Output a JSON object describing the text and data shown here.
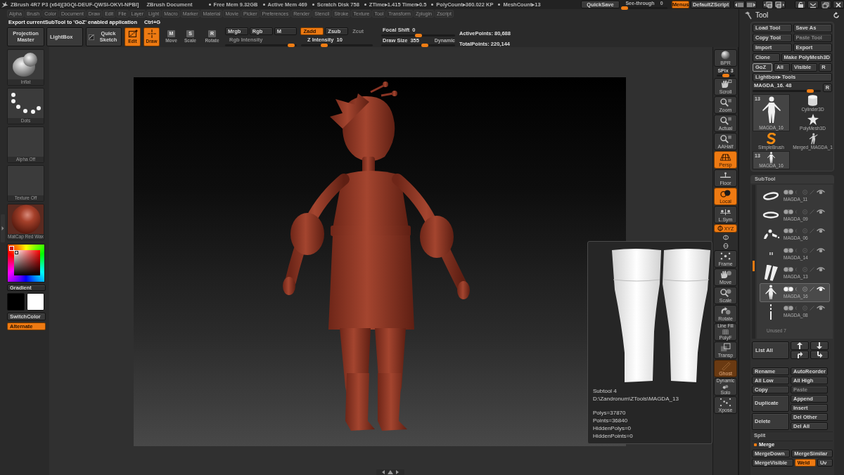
{
  "title_bar": {
    "app_title": "ZBrush 4R7 P3 (x64)[3GQI-DEUF-QWSI-OKVI-NPBI]",
    "document": "ZBrush Document",
    "stats": [
      "Free Mem 9.32GB",
      "Active Mem 469",
      "Scratch Disk 758",
      "ZTime▸1.415 Timer▸0.5",
      "PolyCount▸360.022 KP",
      "MeshCount▸13"
    ],
    "quick_save": "QuickSave",
    "see_through": {
      "label": "See-through",
      "value": "0",
      "level": 0
    },
    "menus": {
      "label": "Menus",
      "on": true
    },
    "script": "DefaultZScript"
  },
  "menu_bar": [
    "Alpha",
    "Brush",
    "Color",
    "Document",
    "Draw",
    "Edit",
    "File",
    "Layer",
    "Light",
    "Macro",
    "Marker",
    "Material",
    "Movie",
    "Picker",
    "Preferences",
    "Render",
    "Stencil",
    "Stroke",
    "Texture",
    "Tool",
    "Transform",
    "Zplugin",
    "Zscript"
  ],
  "hint": {
    "text": "Export currentSubTool to 'GoZ' enabled application",
    "shortcut": "Ctrl+G"
  },
  "top_shelf": {
    "projection_master": "Projection Master",
    "lightbox": "LightBox",
    "quick_sketch": "Quick Sketch",
    "transform_modes": [
      {
        "label": "Edit",
        "kind": "edit",
        "on": true
      },
      {
        "label": "Draw",
        "kind": "draw",
        "on": true
      },
      {
        "label": "Move",
        "kind": "tile",
        "glyph": "M",
        "on": false
      },
      {
        "label": "Scale",
        "kind": "tile",
        "glyph": "S",
        "on": false
      },
      {
        "label": "Rotate",
        "kind": "tile",
        "glyph": "R",
        "on": false
      }
    ],
    "channels": [
      {
        "label": "Mrgb",
        "on": false,
        "disabled": false
      },
      {
        "label": "Rgb",
        "on": false,
        "disabled": false
      },
      {
        "label": "M",
        "on": false,
        "disabled": false
      },
      {
        "label": "Zadd",
        "on": true,
        "disabled": false
      },
      {
        "label": "Zsub",
        "on": false,
        "disabled": false
      },
      {
        "label": "Zcut",
        "on": false,
        "disabled": true
      }
    ],
    "intensity_sliders": [
      {
        "label": "Rgb Intensity",
        "disabled": true,
        "level": 0.97
      },
      {
        "label": "Z Intensity",
        "value": "10",
        "disabled": false,
        "level": 0.3
      }
    ],
    "brush_sliders": [
      {
        "label": "Focal Shift",
        "value": "0",
        "level": 0.5
      },
      {
        "label": "Draw Size",
        "value": "355",
        "level": 0.6
      }
    ],
    "dynamic": "Dynamic",
    "points": [
      "ActivePoints: 80,688",
      "TotalPoints: 220,144"
    ]
  },
  "left_tray": {
    "thumbs": [
      {
        "label": "Inflat",
        "kind": "brush"
      },
      {
        "label": "Dots",
        "kind": "stroke"
      },
      {
        "label": "Alpha Off",
        "kind": "blank"
      },
      {
        "label": "Texture Off",
        "kind": "blank"
      },
      {
        "label": "MatCap Red Wax",
        "kind": "material"
      }
    ],
    "gradient": "Gradient",
    "swatches": [
      {
        "color": "#000000"
      },
      {
        "color": "#ffffff"
      }
    ],
    "switch_color": "SwitchColor",
    "alternate": {
      "label": "Alternate",
      "on": true
    }
  },
  "right_shelf": [
    {
      "kind": "bpr",
      "label": "BPR",
      "on": false,
      "disabled": false
    },
    {
      "kind": "spix",
      "label": "SPix",
      "value": "3",
      "level": 0.5
    },
    {
      "kind": "scroll",
      "label": "Scroll",
      "on": false,
      "disabled": false
    },
    {
      "kind": "zoom",
      "label": "Zoom",
      "on": false,
      "disabled": false
    },
    {
      "kind": "actual",
      "label": "Actual",
      "on": false,
      "disabled": false
    },
    {
      "kind": "aahalf",
      "label": "AAHalf",
      "on": false,
      "disabled": false
    },
    {
      "kind": "persp",
      "label": "Persp",
      "on": true,
      "disabled": false
    },
    {
      "kind": "floor",
      "label": "Floor",
      "on": false,
      "disabled": false
    },
    {
      "kind": "local",
      "label": "Local",
      "on": true,
      "disabled": false
    },
    {
      "kind": "lsym",
      "label": "L.Sym",
      "on": false,
      "disabled": false
    },
    {
      "kind": "xyz",
      "label": "XYZ",
      "on": true,
      "disabled": false
    },
    {
      "kind": "rot_y",
      "on": false,
      "disabled": false
    },
    {
      "kind": "rot_z",
      "on": false,
      "disabled": false
    },
    {
      "kind": "frame",
      "label": "Frame",
      "on": false,
      "disabled": false
    },
    {
      "kind": "move",
      "label": "Move",
      "on": false,
      "disabled": false
    },
    {
      "kind": "scale",
      "label": "Scale",
      "on": false,
      "disabled": false
    },
    {
      "kind": "rotate",
      "label": "Rotate",
      "on": false,
      "disabled": false
    },
    {
      "kind": "polyf",
      "label": "PolyF",
      "tag": "Line Fill",
      "on": false,
      "disabled": false
    },
    {
      "kind": "transp",
      "label": "Transp",
      "on": false,
      "disabled": false
    },
    {
      "kind": "ghost",
      "label": "Ghost",
      "on": true,
      "disabled": true
    },
    {
      "kind": "solo",
      "label": "Solo",
      "tag": "Dynamic",
      "on": false,
      "disabled": false
    },
    {
      "kind": "xpose",
      "label": "Xpose",
      "on": false,
      "disabled": false
    }
  ],
  "subtool_info": {
    "title": "Subtool 4",
    "path": "D:\\Zandronum\\ZTools\\MAGDA_13",
    "stats": [
      "Polys=37870",
      "Points=36840",
      "HiddenPolys=0",
      "HiddenPoints=0"
    ]
  },
  "tool_panel": {
    "title": "Tool",
    "rows": [
      [
        {
          "label": "Load Tool",
          "disabled": false,
          "hovered": false
        },
        {
          "label": "Save As",
          "disabled": false,
          "hovered": false
        }
      ],
      [
        {
          "label": "Copy Tool",
          "disabled": false,
          "hovered": false
        },
        {
          "label": "Paste Tool",
          "disabled": true,
          "hovered": false
        }
      ],
      [
        {
          "label": "Import",
          "disabled": false,
          "hovered": false
        },
        {
          "label": "Export",
          "disabled": false,
          "hovered": false
        }
      ],
      [
        {
          "label": "Clone",
          "disabled": false,
          "hovered": false
        },
        {
          "label": "Make PolyMesh3D",
          "disabled": false,
          "hovered": false
        }
      ],
      [
        {
          "label": "GoZ",
          "disabled": false,
          "hovered": true
        },
        {
          "label": "All",
          "disabled": false,
          "hovered": false
        },
        {
          "label": "Visible",
          "disabled": false,
          "hovered": false
        },
        {
          "label": "R",
          "disabled": false,
          "hovered": false
        }
      ],
      [
        {
          "label": "Lightbox▸ Tools",
          "disabled": false,
          "hovered": false
        }
      ]
    ],
    "current": {
      "label": "MAGDA_16. 48",
      "level": 0.88,
      "reset": "R"
    },
    "tools": [
      {
        "label": "MAGDA_16",
        "count": "13",
        "kind": "figure",
        "large": true
      },
      {
        "label": "Cylinder3D",
        "kind": "cylinder",
        "large": false
      },
      {
        "label": "PolyMesh3D",
        "kind": "star",
        "large": false
      },
      {
        "label": "SimpleBrush",
        "kind": "swirl",
        "large": false
      },
      {
        "label": "Merged_MAGDA_1",
        "kind": "pose",
        "large": false
      },
      {
        "label": "MAGDA_16",
        "count": "13",
        "kind": "figure",
        "large": false
      }
    ]
  },
  "subtool_panel": {
    "title": "SubTool",
    "subtools": [
      {
        "name": "MAGDA_11",
        "kind": "ring",
        "selected": false,
        "visible": true
      },
      {
        "name": "MAGDA_09",
        "kind": "band",
        "selected": false,
        "visible": true
      },
      {
        "name": "MAGDA_06",
        "kind": "top",
        "selected": false,
        "visible": true
      },
      {
        "name": "MAGDA_14",
        "kind": "bits",
        "selected": false,
        "visible": true
      },
      {
        "name": "MAGDA_13",
        "kind": "legs",
        "selected": false,
        "visible": true
      },
      {
        "name": "MAGDA_16",
        "kind": "figure",
        "selected": true,
        "visible": true
      },
      {
        "name": "MAGDA_08",
        "kind": "stick",
        "selected": false,
        "visible": true
      }
    ],
    "unused": "Unused 7",
    "list_all": "List All",
    "action_rows": [
      {
        "kind": "pair",
        "buttons": [
          {
            "label": "Rename",
            "disabled": false
          },
          {
            "label": "AutoReorder",
            "disabled": false
          }
        ]
      },
      {
        "kind": "pair",
        "buttons": [
          {
            "label": "All Low",
            "disabled": false
          },
          {
            "label": "All High",
            "disabled": false
          }
        ]
      },
      {
        "kind": "pair",
        "buttons": [
          {
            "label": "Copy",
            "disabled": false
          },
          {
            "label": "Paste",
            "disabled": true
          }
        ]
      },
      {
        "kind": "stack",
        "main": {
          "label": "Duplicate",
          "disabled": false
        },
        "buttons": [
          {
            "label": "Append",
            "disabled": false
          },
          {
            "label": "Insert",
            "disabled": false
          }
        ]
      },
      {
        "kind": "stack",
        "main": {
          "label": "Delete",
          "disabled": false
        },
        "buttons": [
          {
            "label": "Del Other",
            "disabled": false
          },
          {
            "label": "Del All",
            "disabled": false
          }
        ]
      }
    ],
    "sections": [
      {
        "label": "Split",
        "expanded": false
      },
      {
        "label": "Merge",
        "expanded": true,
        "rows": [
          [
            {
              "label": "MergeDown",
              "on": false
            },
            {
              "label": "MergeSimilar",
              "on": false
            }
          ],
          [
            {
              "label": "MergeVisible",
              "on": false
            },
            {
              "label": "Weld",
              "on": true
            },
            {
              "label": "Uv",
              "on": false
            }
          ]
        ]
      }
    ]
  }
}
